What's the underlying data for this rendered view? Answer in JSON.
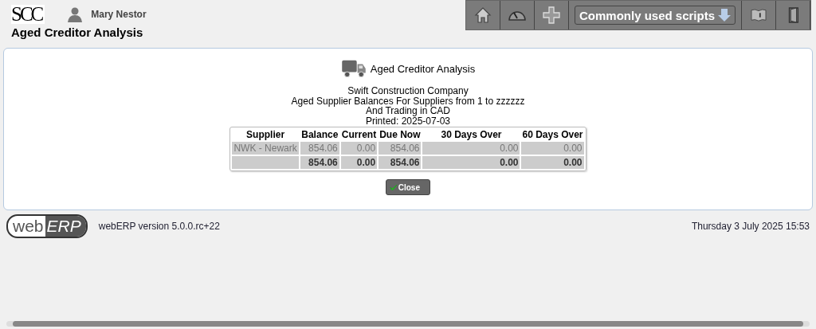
{
  "header": {
    "company_logo": "SCC",
    "user": "Mary Nestor",
    "page_title": "Aged Creditor Analysis"
  },
  "toolbar": {
    "menu_label": "Commonly used scripts"
  },
  "report": {
    "title": "Aged Creditor Analysis",
    "lines": [
      "Swift Construction Company",
      "Aged Supplier Balances For Suppliers from 1 to zzzzzz",
      "And Trading in CAD",
      "Printed: 2025-07-03"
    ],
    "table": {
      "columns": [
        "Supplier",
        "Balance",
        "Current",
        "Due Now",
        "30 Days Over",
        "60 Days Over"
      ],
      "rows": [
        {
          "kind": "data",
          "cells": [
            "NWK - Newark",
            "854.06",
            "0.00",
            "854.06",
            "0.00",
            "0.00"
          ]
        },
        {
          "kind": "total",
          "cells": [
            "",
            "854.06",
            "0.00",
            "854.06",
            "0.00",
            "0.00"
          ]
        }
      ]
    },
    "close_button": "Close"
  },
  "footer": {
    "logo": {
      "left": "web",
      "right": "ERP"
    },
    "version": "webERP version 5.0.0.rc+22",
    "datetime": "Thursday 3 July 2025 15:53"
  }
}
